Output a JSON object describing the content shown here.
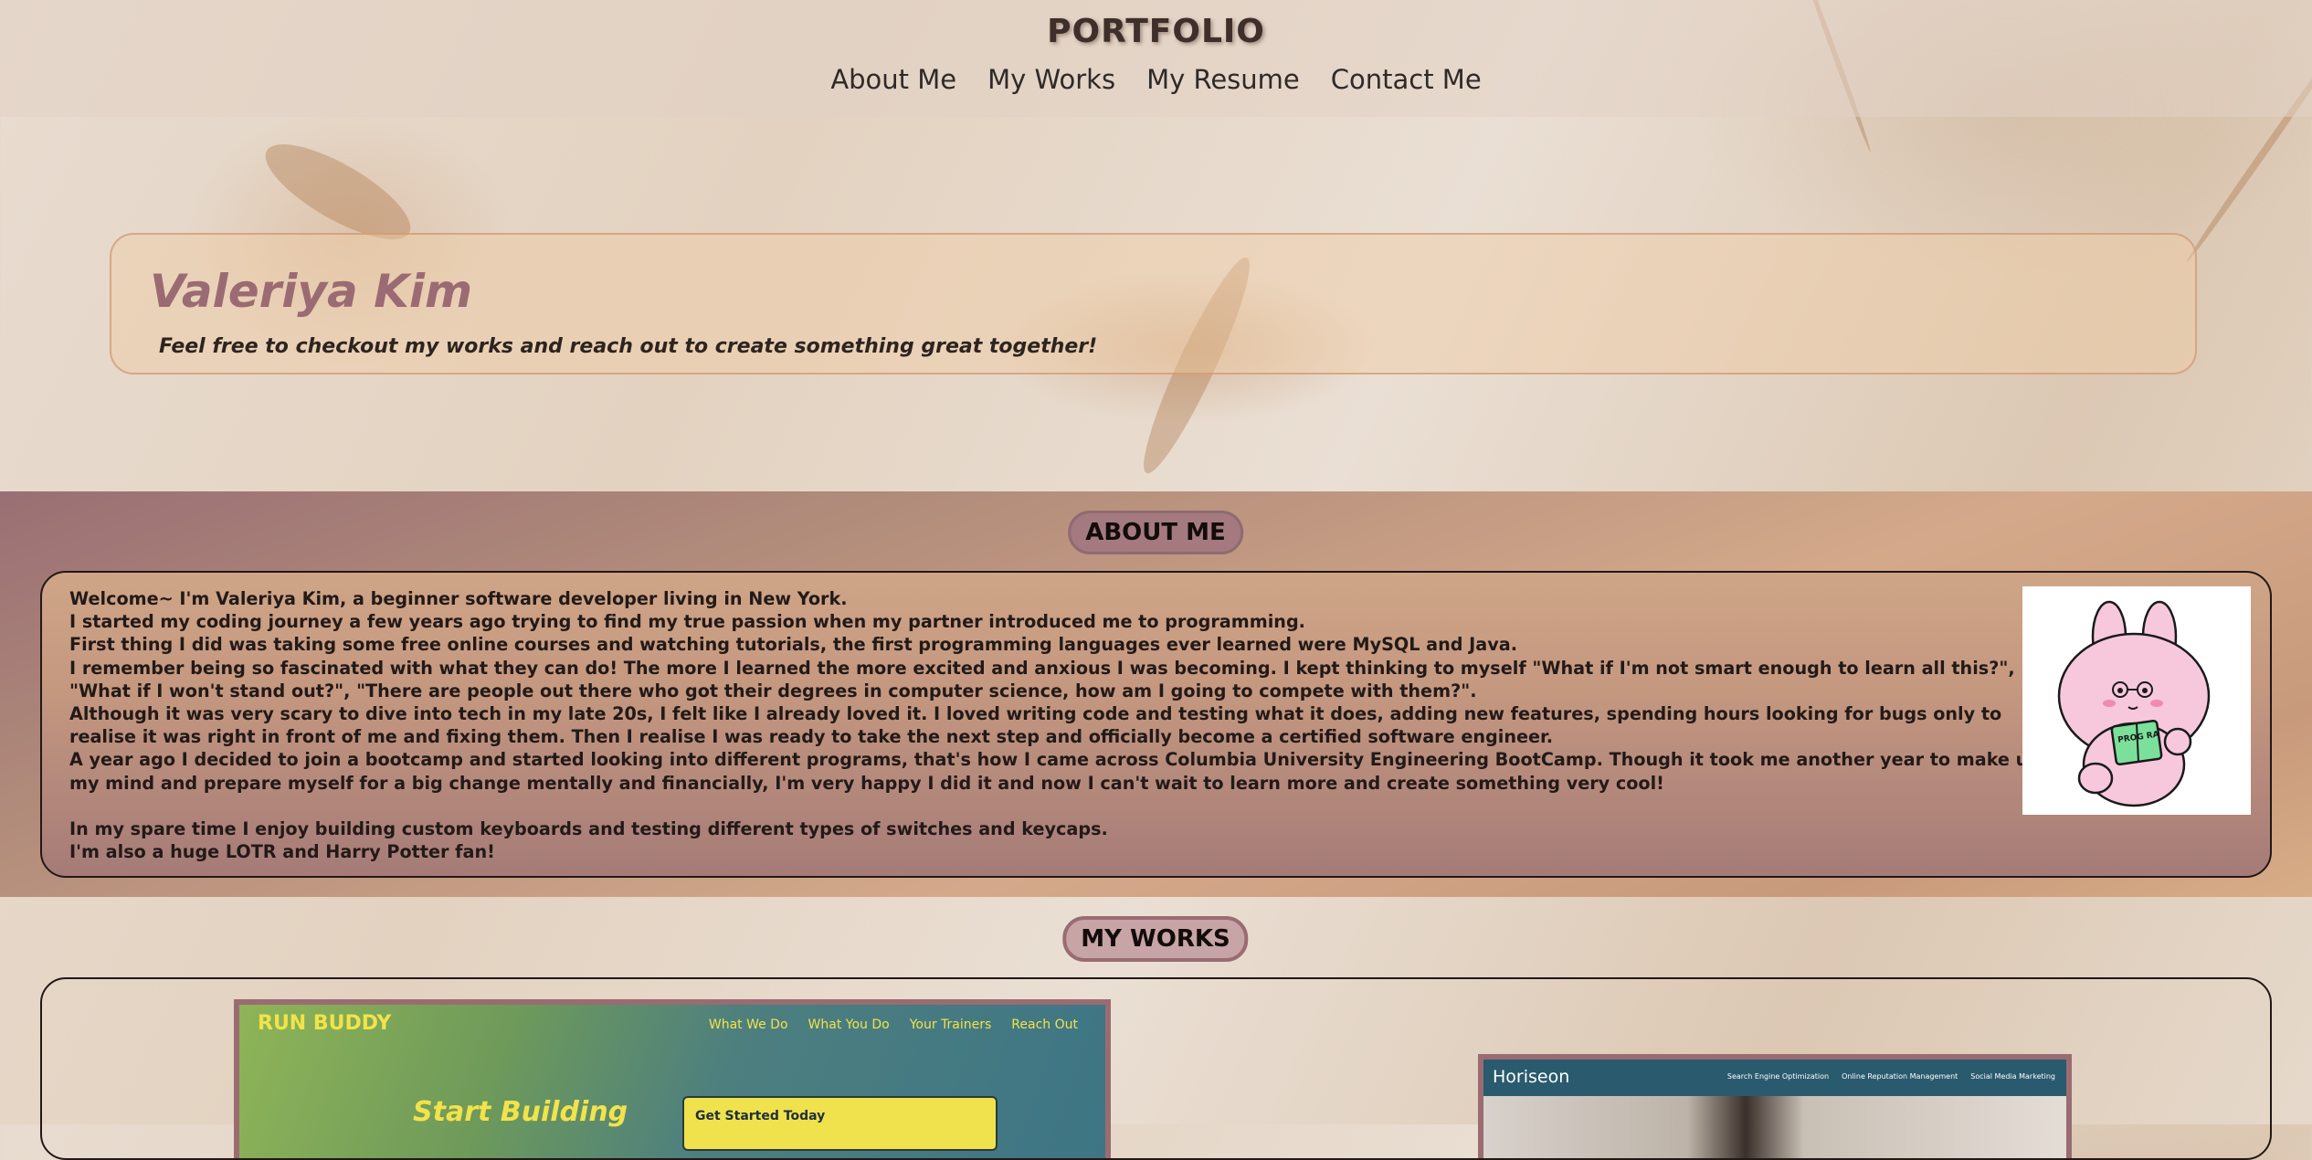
{
  "header": {
    "title": "PORTFOLIO",
    "nav": [
      "About Me",
      "My Works",
      "My Resume",
      "Contact Me"
    ]
  },
  "hero": {
    "name": "Valeriya Kim",
    "tagline": "Feel free to checkout my works and reach out to create something great together!"
  },
  "about": {
    "heading": "ABOUT ME",
    "paragraphs": [
      "Welcome~ I'm Valeriya Kim, a beginner software developer living in New York.",
      "I started my coding journey a few years ago trying to find my true passion when my partner introduced me to programming.",
      "First thing I did was taking some free online courses and watching tutorials, the first programming languages ever learned were MySQL and Java.",
      "I remember being so fascinated with what they can do! The more I learned the more excited and anxious I was becoming. I kept thinking to myself \"What if I'm not smart enough to learn all this?\", \"What if I won't stand out?\", \"There are people out there who got their degrees in computer science, how am I going to compete with them?\".",
      "Although it was very scary to dive into tech in my late 20s, I felt like I already loved it. I loved writing code and testing what it does, adding new features, spending hours looking for bugs only to realise it was right in front of me and fixing them. Then I realise I was ready to take the next step and officially become a certified software engineer.",
      "A year ago I decided to join a bootcamp and started looking into different programs, that's how I came across Columbia University Engineering BootCamp. Though it took me another year to make up my mind and prepare myself for a big change mentally and financially, I'm very happy I did it and now I can't wait to learn more and create something very cool!",
      "In my spare time I enjoy building custom keyboards and testing different types of switches and keycaps.",
      "I'm also a huge LOTR and Harry Potter fan!"
    ],
    "avatar_icon": "pink-bunny-reading-book-icon",
    "book_text": "PROG RA"
  },
  "works": {
    "heading": "MY WORKS",
    "project1": {
      "logo": "RUN BUDDY",
      "nav": [
        "What We Do",
        "What You Do",
        "Your Trainers",
        "Reach Out"
      ],
      "hero_text": "Start Building",
      "cta": "Get Started Today"
    },
    "project2": {
      "logo": "Horiseon",
      "nav": [
        "Search Engine Optimization",
        "Online Reputation Management",
        "Social Media Marketing"
      ]
    }
  },
  "colors": {
    "accent": "#9b6b74",
    "band": "#c89a7c",
    "marble": "#e6d9cb"
  }
}
